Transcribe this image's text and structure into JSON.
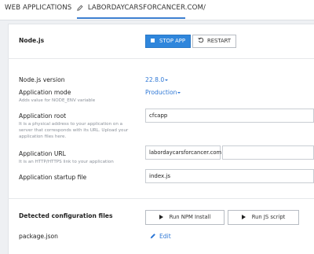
{
  "tabs": {
    "webapps_label": "WEB APPLICATIONS",
    "domain_label": "LABORDAYCARSFORCANCER.COM/"
  },
  "app": {
    "section_title": "Node.js",
    "stop_label": "STOP APP",
    "restart_label": "RESTART"
  },
  "fields": {
    "version_label": "Node.js version",
    "version_value": "22.8.0",
    "mode_label": "Application mode",
    "mode_value": "Production",
    "mode_hint": "Adds value for NODE_ENV variable",
    "root_label": "Application root",
    "root_hint": "It is a physical address to your application on a server that corresponds with its URL. Upload your application files here.",
    "root_value": "cfcapp",
    "url_label": "Application URL",
    "url_hint": "It is an HTTP/HTTPS link to your application",
    "url_domain": "labordaycarsforcancer.com",
    "startup_label": "Application startup file",
    "startup_value": "index.js"
  },
  "config": {
    "title": "Detected configuration files",
    "npm_label": "Run NPM Install",
    "js_label": "Run JS script",
    "file_name": "package.json",
    "edit_label": "Edit"
  },
  "colors": {
    "accent": "#2f86dc",
    "link": "#2f78d6"
  }
}
